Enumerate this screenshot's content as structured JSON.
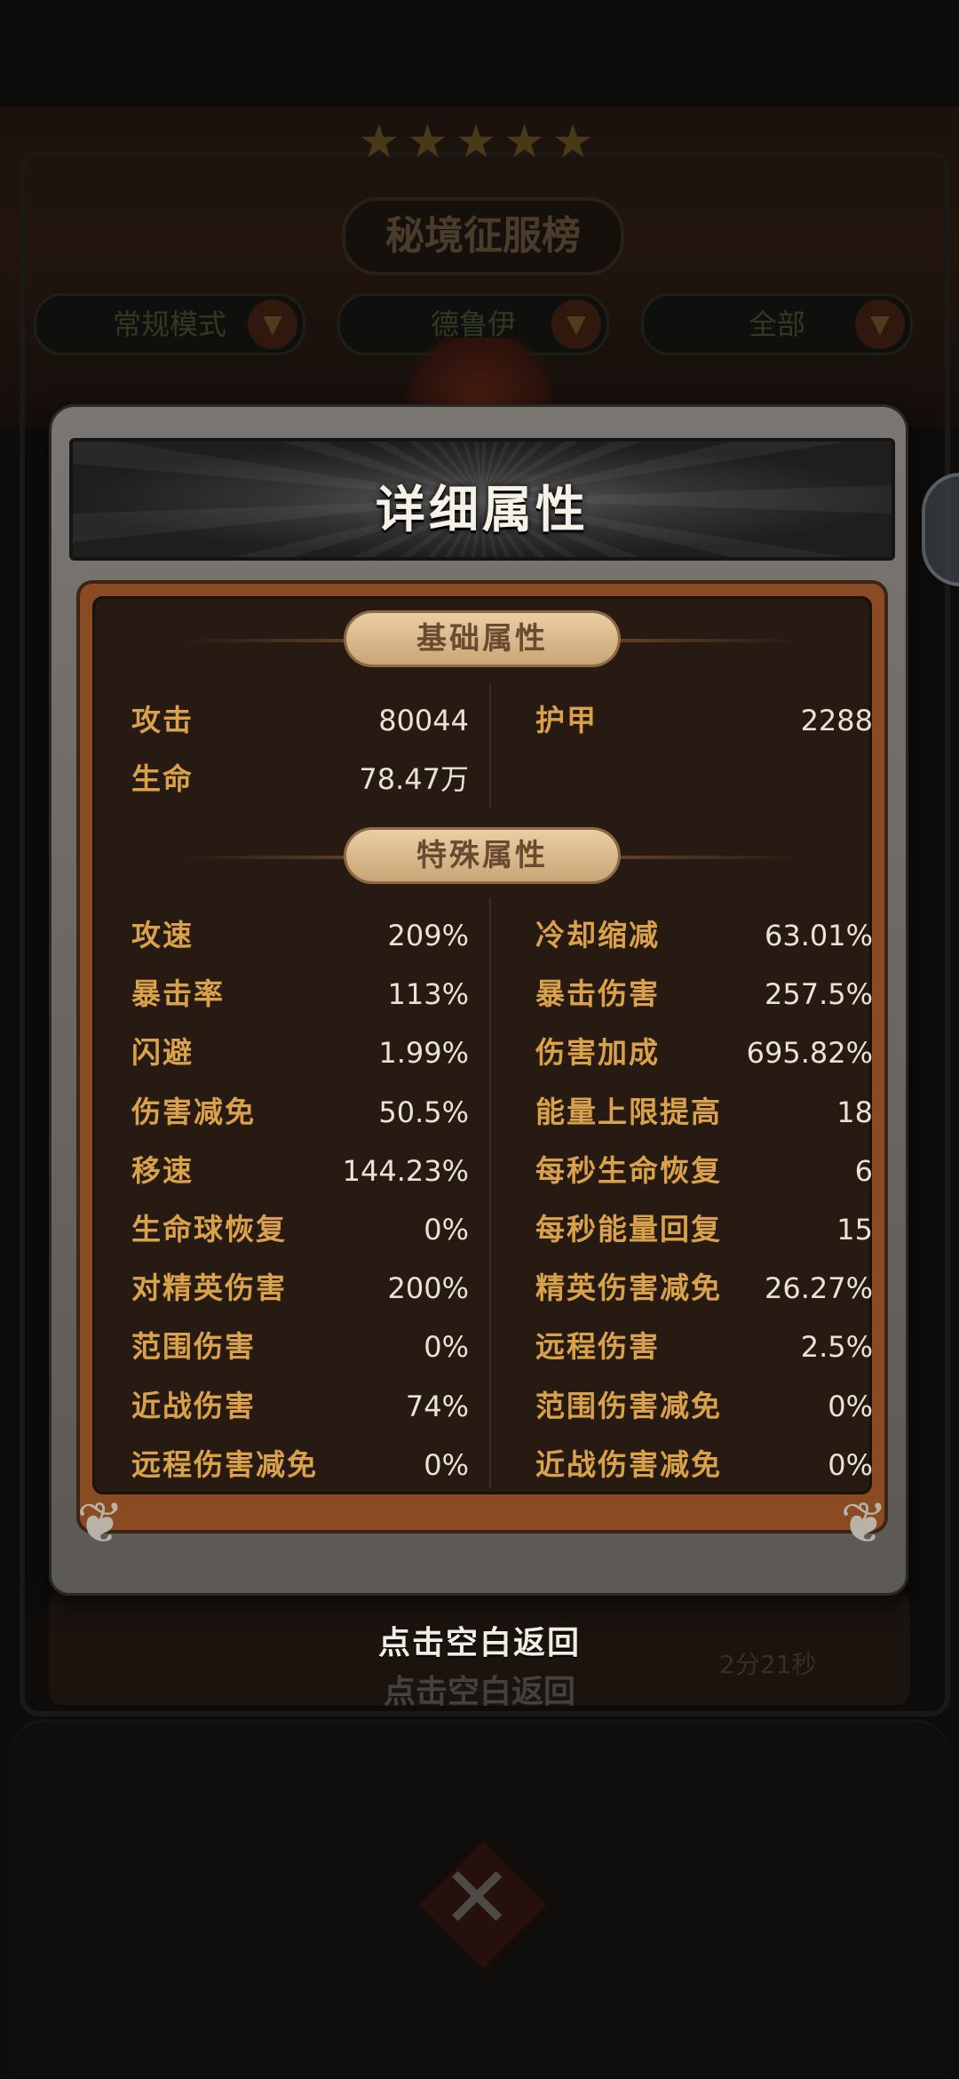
{
  "background": {
    "leaderboard_title": "秘境征服榜",
    "stars": "★★★★★",
    "filters": [
      {
        "label": "常规模式"
      },
      {
        "label": "德鲁伊"
      },
      {
        "label": "全部"
      }
    ],
    "entry_time": "2分21秒",
    "ghost_dismiss": "点击空白返回"
  },
  "dialog": {
    "title": "详细属性",
    "basic_section": {
      "title": "基础属性",
      "left": [
        {
          "label": "攻击",
          "value": "80044"
        },
        {
          "label": "生命",
          "value": "78.47万"
        }
      ],
      "right": [
        {
          "label": "护甲",
          "value": "2288"
        }
      ]
    },
    "special_section": {
      "title": "特殊属性",
      "left": [
        {
          "label": "攻速",
          "value": "209%"
        },
        {
          "label": "暴击率",
          "value": "113%"
        },
        {
          "label": "闪避",
          "value": "1.99%"
        },
        {
          "label": "伤害减免",
          "value": "50.5%"
        },
        {
          "label": "移速",
          "value": "144.23%"
        },
        {
          "label": "生命球恢复",
          "value": "0%"
        },
        {
          "label": "对精英伤害",
          "value": "200%"
        },
        {
          "label": "范围伤害",
          "value": "0%"
        },
        {
          "label": "近战伤害",
          "value": "74%"
        },
        {
          "label": "远程伤害减免",
          "value": "0%"
        }
      ],
      "right": [
        {
          "label": "冷却缩减",
          "value": "63.01%"
        },
        {
          "label": "暴击伤害",
          "value": "257.5%"
        },
        {
          "label": "伤害加成",
          "value": "695.82%"
        },
        {
          "label": "能量上限提高",
          "value": "18"
        },
        {
          "label": "每秒生命恢复",
          "value": "6"
        },
        {
          "label": "每秒能量回复",
          "value": "15"
        },
        {
          "label": "精英伤害减免",
          "value": "26.27%"
        },
        {
          "label": "远程伤害",
          "value": "2.5%"
        },
        {
          "label": "范围伤害减免",
          "value": "0%"
        },
        {
          "label": "近战伤害减免",
          "value": "0%"
        }
      ]
    }
  },
  "dismiss_text": "点击空白返回",
  "icons": {
    "filter_arrow": "▼",
    "corner": "❦",
    "close": "✕"
  }
}
